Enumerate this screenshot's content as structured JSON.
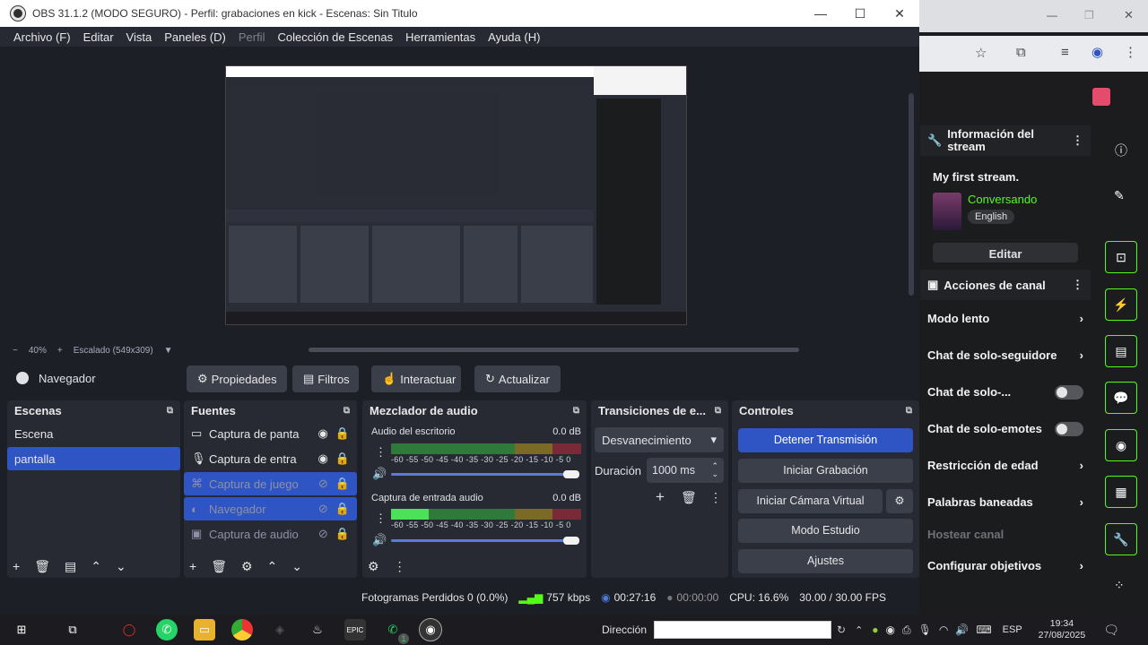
{
  "window": {
    "title": "OBS 31.1.2 (MODO SEGURO) - Perfil: grabaciones en kick - Escenas: Sin Titulo",
    "min": "—",
    "max": "☐",
    "close": "✕"
  },
  "menu": {
    "items": [
      "Archivo (F)",
      "Editar",
      "Vista",
      "Paneles (D)",
      "Perfil",
      "Colección de Escenas",
      "Herramientas",
      "Ayuda (H)"
    ]
  },
  "zoom": {
    "minus": "−",
    "level": "40%",
    "plus": "+",
    "scale": "Escalado (549x309)"
  },
  "source_toolbar": {
    "source_name": "Navegador",
    "properties": "Propiedades",
    "filters": "Filtros",
    "interact": "Interactuar",
    "refresh": "Actualizar"
  },
  "scenes": {
    "title": "Escenas",
    "items": [
      "Escena",
      "pantalla"
    ]
  },
  "sources": {
    "title": "Fuentes",
    "items": [
      "Captura de panta",
      "Captura de entra",
      "Captura de juego",
      "Navegador",
      "Captura de audio"
    ]
  },
  "mixer": {
    "title": "Mezclador de audio",
    "channels": [
      {
        "name": "Audio del escritorio",
        "db": "0.0 dB"
      },
      {
        "name": "Captura de entrada audio",
        "db": "0.0 dB"
      }
    ],
    "scale": "-60 -55 -50 -45 -40 -35 -30 -25 -20 -15 -10 -5 0"
  },
  "transitions": {
    "title": "Transiciones de e...",
    "selected": "Desvanecimiento",
    "duration_label": "Duración",
    "duration_value": "1000 ms"
  },
  "controls": {
    "title": "Controles",
    "stop_stream": "Detener Transmisión",
    "start_recording": "Iniciar Grabación",
    "start_virtual_cam": "Iniciar Cámara Virtual",
    "studio_mode": "Modo Estudio",
    "settings": "Ajustes"
  },
  "status": {
    "dropped": "Fotogramas Perdidos 0 (0.0%)",
    "bitrate": "757 kbps",
    "stream_time": "00:27:16",
    "rec_time": "00:00:00",
    "cpu": "CPU: 16.6%",
    "fps": "30.00 / 30.00 FPS"
  },
  "kick": {
    "info_title": "Información del stream",
    "stream_title": "My first stream.",
    "category": "Conversando",
    "language": "English",
    "edit": "Editar",
    "actions_title": "Acciones de canal",
    "actions": [
      "Modo lento",
      "Chat de solo-seguidore",
      "Chat de solo-...",
      "Chat de solo-emotes",
      "Restricción de edad",
      "Palabras baneadas",
      "Hostear canal",
      "Configurar objetivos"
    ]
  },
  "taskbar": {
    "direccion_label": "Dirección",
    "lang": "ESP",
    "time": "19:34",
    "date": "27/08/2025",
    "whatsapp_badge": "1"
  },
  "colors": {
    "accent": "#2f54c4",
    "kick_green": "#53fc18",
    "panel": "#272a33",
    "bg": "#1d1f26"
  }
}
